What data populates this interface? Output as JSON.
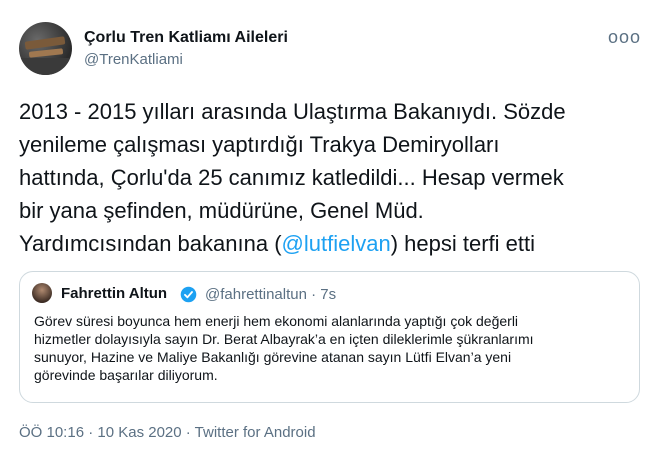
{
  "author": {
    "name": "Çorlu Tren Katliamı Aileleri",
    "handle": "@TrenKatliami"
  },
  "menu_icon": "more-dots-icon",
  "menu_glyph": "ooo",
  "tweet": {
    "lines": [
      "2013 - 2015 yılları arasında Ulaştırma Bakanıydı. Sözde",
      "yenileme çalışması yaptırdığı Trakya Demiryolları",
      "hattında, Çorlu'da 25 canımız katledildi... Hesap vermek",
      "bir yana şefinden, müdürüne, Genel Müd."
    ],
    "last_line_prefix": "Yardımcısından bakanına (",
    "mention": "@lutfielvan",
    "last_line_suffix": ") hepsi terfi etti"
  },
  "quoted": {
    "name": "Fahrettin Altun",
    "verified": true,
    "verified_color": "#1da1f2",
    "handle_time": "@fahrettinaltun · 7s",
    "lines": [
      "Görev süresi boyunca hem enerji hem ekonomi alanlarında yaptığı çok değerli",
      "hizmetler dolayısıyla sayın Dr. Berat Albayrak’a en içten dileklerimle şükranlarımı",
      "sunuyor, Hazine ve Maliye Bakanlığı görevine atanan sayın Lütfi Elvan’a yeni",
      "görevinde başarılar diliyorum."
    ]
  },
  "footer": {
    "meta": "ÖÖ 10:16 · 10 Kas 2020 · Twitter for Android"
  },
  "colors": {
    "accent": "#1da1f2",
    "text": "#0f1419",
    "secondary": "#5b7083",
    "border": "#cfd9de"
  }
}
